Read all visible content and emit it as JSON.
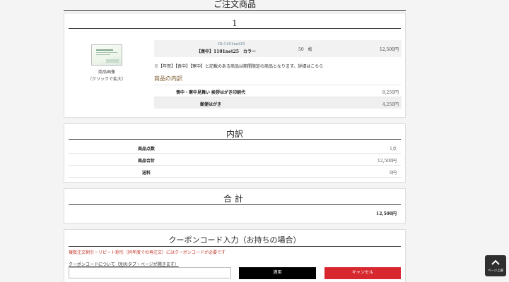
{
  "page": {
    "title": "ご注文商品"
  },
  "item": {
    "number": "1",
    "thumb_caption_1": "商品画像",
    "thumb_caption_2": "（クリックで拡大）",
    "id": "ID:1101net25",
    "name": "【喪中】1101net25　カラー",
    "qty": "50　枚",
    "price": "12,500円",
    "note_prefix": "※【年賀】【喪中】【寒中】と記載のある商品は期間限定の商品となります。",
    "note_link": "詳細はこちら",
    "breakdown_title": "商品の内訳",
    "breakdown": [
      {
        "label": "喪中・寒中見舞い 挨拶はがき印刷代",
        "value": "8,250円"
      },
      {
        "label": "郵便はがき",
        "value": "4,250円"
      }
    ]
  },
  "summary": {
    "heading": "内訳",
    "rows": [
      {
        "label": "商品点数",
        "value": "1点"
      },
      {
        "label": "商品合計",
        "value": "12,500円"
      },
      {
        "label": "送料",
        "value": "0円"
      }
    ]
  },
  "total": {
    "heading": "合計",
    "value": "12,500円"
  },
  "coupon": {
    "heading": "クーポンコード入力（お持ちの場合）",
    "note": "複数注文割引・リピート割引（同年度での再注文）にはクーポンコードが必要です",
    "link": "クーポンコードについて（別のタブ・ページが開きます）",
    "input_value": "",
    "apply_label": "適用",
    "cancel_label": "キャンセル"
  },
  "pagetop": {
    "label": "ページ上部"
  }
}
